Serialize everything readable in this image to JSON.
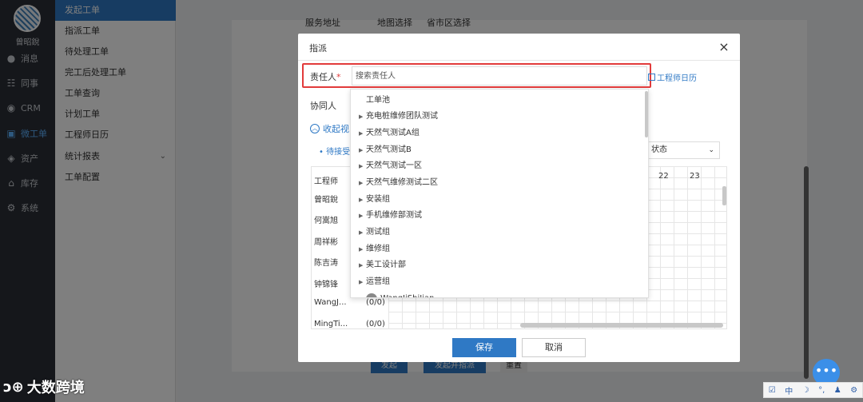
{
  "user": {
    "name": "曾昭銳"
  },
  "rail": {
    "items": [
      {
        "label": "消息",
        "icon": "message-icon"
      },
      {
        "label": "同事",
        "icon": "colleague-icon"
      },
      {
        "label": "CRM",
        "icon": "crm-icon"
      },
      {
        "label": "微工单",
        "icon": "workorder-icon"
      },
      {
        "label": "资产",
        "icon": "asset-icon"
      },
      {
        "label": "库存",
        "icon": "inventory-icon"
      },
      {
        "label": "系统",
        "icon": "gear-icon"
      }
    ]
  },
  "submenu": {
    "items": [
      {
        "label": "发起工单"
      },
      {
        "label": "指派工单"
      },
      {
        "label": "待处理工单"
      },
      {
        "label": "完工后处理工单"
      },
      {
        "label": "工单查询"
      },
      {
        "label": "计划工单"
      },
      {
        "label": "工程师日历"
      },
      {
        "label": "统计报表"
      },
      {
        "label": "工单配置"
      }
    ]
  },
  "background": {
    "service_address": "服务地址",
    "radio_map": "地图选择",
    "radio_region": "省市区选择",
    "btn_submit": "发起",
    "btn_submit_assign": "发起并指派",
    "btn_reset": "重置"
  },
  "dialog": {
    "title": "指派",
    "close": "×",
    "assignee_label": "责任人",
    "required_mark": "*",
    "search_placeholder": "搜索责任人",
    "engineer_calendar": "工程师日历",
    "collaborator_label": "协同人",
    "collapse_label": "收起视",
    "pending_label": "• 待接受",
    "status_select": "状态",
    "grid_header": "工程师",
    "hours": [
      "22",
      "23"
    ],
    "engineers": [
      {
        "name": "曾昭銳",
        "count": ""
      },
      {
        "name": "何嵩旭",
        "count": ""
      },
      {
        "name": "周祥彬",
        "count": ""
      },
      {
        "name": "陈吉涛",
        "count": ""
      },
      {
        "name": "钟锦锋",
        "count": ""
      },
      {
        "name": "WangJ...",
        "count": "(0/0)"
      },
      {
        "name": "MingTi...",
        "count": "(0/0)"
      }
    ],
    "dropdown": {
      "root": "工单池",
      "groups": [
        "充电桩维修团队测试",
        "天然气测试A组",
        "天然气测试B",
        "天然气测试一区",
        "天然气维修测试二区",
        "安装组",
        "手机维修部测试",
        "测试组",
        "维修组",
        "美工设计部",
        "运营组"
      ],
      "partial_user": "WangJiShiJian"
    },
    "save": "保存",
    "cancel": "取消"
  },
  "widgets": {
    "fab": "•••",
    "ime": [
      "中",
      "☽",
      "°,",
      "♟",
      "⚙"
    ],
    "watermark": "大数跨境"
  },
  "colors": {
    "accent": "#2f79c5",
    "highlight": "#e23b3b",
    "rail": "#2b2f36"
  }
}
